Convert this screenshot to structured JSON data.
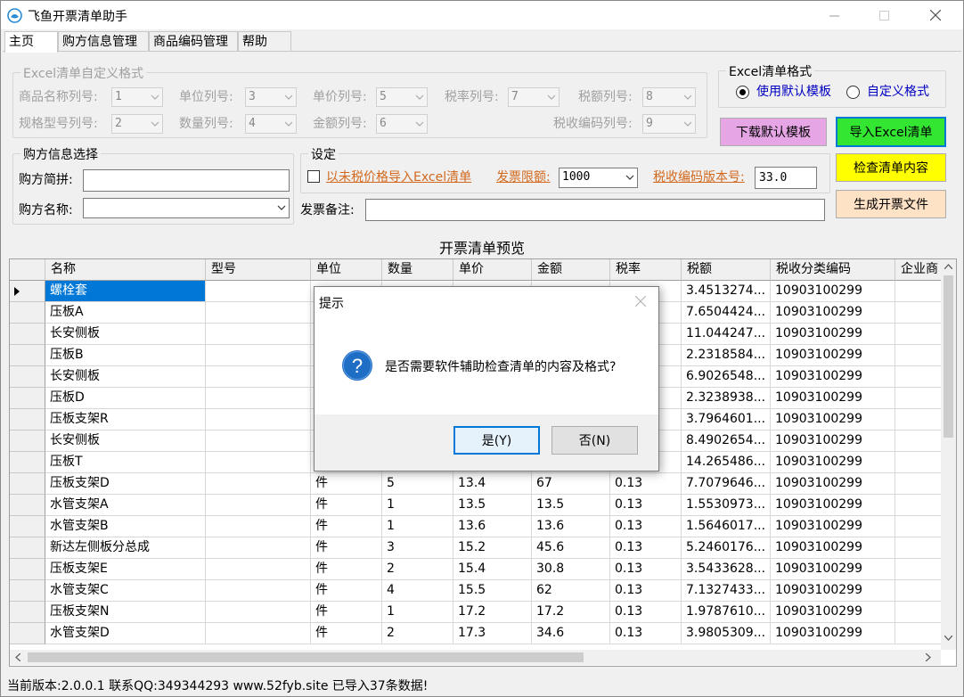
{
  "window": {
    "title": "飞鱼开票清单助手"
  },
  "tabs": [
    "主页",
    "购方信息管理",
    "商品编码管理",
    "帮助"
  ],
  "excel_format_group": {
    "title": "Excel清单自定义格式",
    "fields": [
      {
        "label": "商品名称列号:",
        "value": "1"
      },
      {
        "label": "单位列号:",
        "value": "3"
      },
      {
        "label": "单价列号:",
        "value": "5"
      },
      {
        "label": "税率列号:",
        "value": "7"
      },
      {
        "label": "税额列号:",
        "value": "8"
      },
      {
        "label": "规格型号列号:",
        "value": "2"
      },
      {
        "label": "数量列号:",
        "value": "4"
      },
      {
        "label": "金额列号:",
        "value": "6"
      },
      {
        "label": "税收编码列号:",
        "value": "9"
      }
    ]
  },
  "list_format_group": {
    "title": "Excel清单格式",
    "option_default": "使用默认模板",
    "option_custom": "自定义格式"
  },
  "buttons": {
    "download_template": "下载默认模板",
    "import_excel": "导入Excel清单",
    "check_content": "检查清单内容",
    "generate_file": "生成开票文件"
  },
  "buyer_group": {
    "title": "购方信息选择",
    "abbr_label": "购方简拼:",
    "abbr_value": "",
    "name_label": "购方名称:",
    "name_value": ""
  },
  "settings_group": {
    "title": "设定",
    "untaxed_label": "以未税价格导入Excel清单",
    "limit_label": "发票限额:",
    "limit_value": "1000",
    "code_version_label": "税收编码版本号:",
    "code_version_value": "33.0",
    "remark_label": "发票备注:",
    "remark_value": ""
  },
  "preview": {
    "title": "开票清单预览",
    "columns": [
      "名称",
      "型号",
      "单位",
      "数量",
      "单价",
      "金额",
      "税率",
      "税额",
      "税收分类编码",
      "企业商"
    ],
    "rows": [
      [
        "螺栓套",
        "",
        "",
        "",
        "",
        "",
        "",
        "3.4513274...",
        "10903100299",
        ""
      ],
      [
        "压板A",
        "",
        "",
        "",
        "",
        "",
        "",
        "7.6504424...",
        "10903100299",
        ""
      ],
      [
        "长安侧板",
        "",
        "",
        "",
        "",
        "",
        "",
        "11.044247...",
        "10903100299",
        ""
      ],
      [
        "压板B",
        "",
        "",
        "",
        "",
        "",
        "",
        "2.2318584...",
        "10903100299",
        ""
      ],
      [
        "长安侧板",
        "",
        "",
        "",
        "",
        "",
        "",
        "6.9026548...",
        "10903100299",
        ""
      ],
      [
        "压板D",
        "",
        "",
        "",
        "",
        "",
        "",
        "2.3238938...",
        "10903100299",
        ""
      ],
      [
        "压板支架R",
        "",
        "",
        "",
        "",
        "",
        "",
        "3.7964601...",
        "10903100299",
        ""
      ],
      [
        "长安侧板",
        "",
        "",
        "",
        "",
        "",
        "",
        "8.4902654...",
        "10903100299",
        ""
      ],
      [
        "压板T",
        "",
        "",
        "",
        "",
        "",
        "",
        "14.265486...",
        "10903100299",
        ""
      ],
      [
        "压板支架D",
        "",
        "件",
        "5",
        "13.4",
        "67",
        "0.13",
        "7.7079646...",
        "10903100299",
        ""
      ],
      [
        "水管支架A",
        "",
        "件",
        "1",
        "13.5",
        "13.5",
        "0.13",
        "1.5530973...",
        "10903100299",
        ""
      ],
      [
        "水管支架B",
        "",
        "件",
        "1",
        "13.6",
        "13.6",
        "0.13",
        "1.5646017...",
        "10903100299",
        ""
      ],
      [
        "新达左侧板分总成",
        "",
        "件",
        "3",
        "15.2",
        "45.6",
        "0.13",
        "5.2460176...",
        "10903100299",
        ""
      ],
      [
        "压板支架E",
        "",
        "件",
        "2",
        "15.4",
        "30.8",
        "0.13",
        "3.5433628...",
        "10903100299",
        ""
      ],
      [
        "水管支架C",
        "",
        "件",
        "4",
        "15.5",
        "62",
        "0.13",
        "7.1327433...",
        "10903100299",
        ""
      ],
      [
        "压板支架N",
        "",
        "件",
        "1",
        "17.2",
        "17.2",
        "0.13",
        "1.9787610...",
        "10903100299",
        ""
      ],
      [
        "水管支架D",
        "",
        "件",
        "2",
        "17.3",
        "34.6",
        "0.13",
        "3.9805309...",
        "10903100299",
        ""
      ]
    ]
  },
  "status": "当前版本:2.0.0.1   联系QQ:349344293   www.52fyb.site 已导入37条数据!",
  "dialog": {
    "title": "提示",
    "message": "是否需要软件辅助检查清单的内容及格式?",
    "yes": "是(Y)",
    "no": "否(N)"
  },
  "colors": {
    "selection": "#0078d7",
    "import_btn": "#32e632",
    "check_btn": "#ffff00",
    "generate_btn": "#fde2c6",
    "download_btn": "#e6a6e6",
    "link": "#d2691e"
  }
}
